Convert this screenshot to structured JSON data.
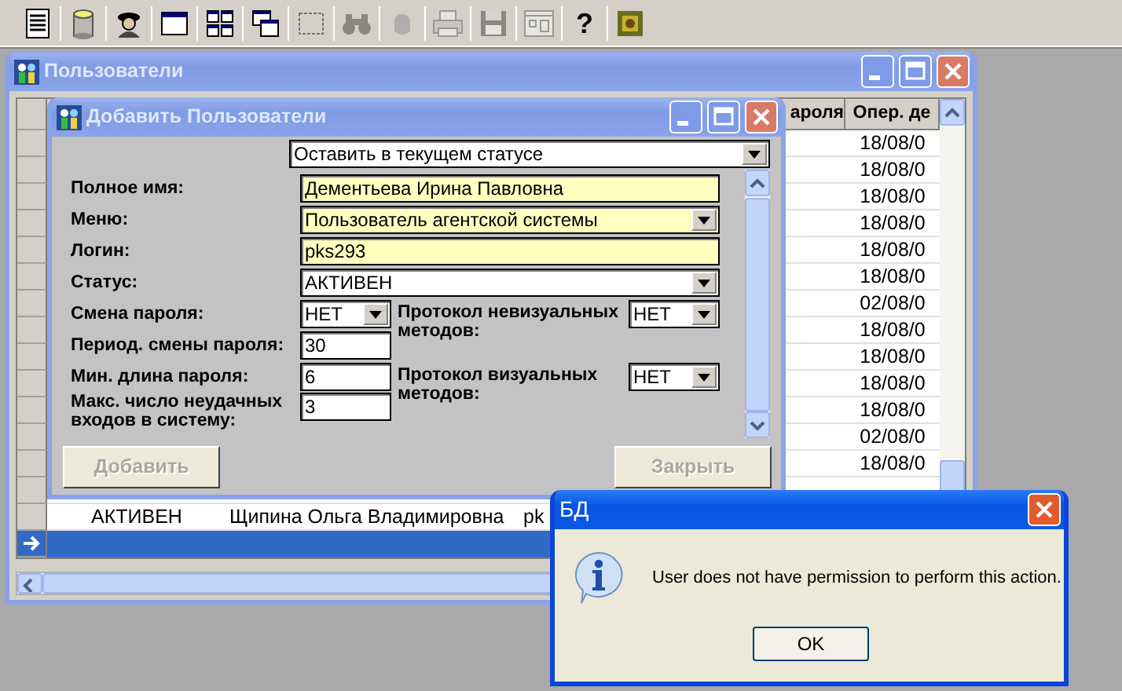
{
  "toolbar": [
    {
      "kind": "document",
      "disabled": false
    },
    {
      "kind": "database",
      "disabled": false
    },
    {
      "kind": "person",
      "disabled": false
    },
    {
      "kind": "window",
      "disabled": false
    },
    {
      "kind": "tile",
      "disabled": false
    },
    {
      "kind": "cascade",
      "disabled": false
    },
    {
      "kind": "frame",
      "disabled": true
    },
    {
      "kind": "binoculars",
      "disabled": true
    },
    {
      "kind": "hand",
      "disabled": true
    },
    {
      "kind": "printer",
      "disabled": true
    },
    {
      "kind": "save",
      "disabled": true
    },
    {
      "kind": "panel",
      "disabled": true
    },
    {
      "kind": "help",
      "glyph": "?",
      "disabled": false
    },
    {
      "kind": "emblem",
      "disabled": false
    }
  ],
  "users_window": {
    "title": "Пользователи",
    "active": false,
    "table": {
      "headings": {
        "column_4": "ароля",
        "column_5": "Опер. де"
      },
      "rows": [
        {
          "column_5": "18/08/0",
          "selected": false,
          "current": false
        },
        {
          "column_5": "18/08/0",
          "selected": false,
          "current": false
        },
        {
          "column_5": "18/08/0",
          "selected": false,
          "current": false
        },
        {
          "column_5": "18/08/0",
          "selected": false,
          "current": false
        },
        {
          "column_5": "18/08/0",
          "selected": false,
          "current": false
        },
        {
          "column_5": "18/08/0",
          "selected": false,
          "current": false
        },
        {
          "column_5": "02/08/0",
          "selected": false,
          "current": false
        },
        {
          "column_5": "18/08/0",
          "selected": false,
          "current": false
        },
        {
          "column_5": "18/08/0",
          "selected": false,
          "current": false
        },
        {
          "column_5": "18/08/0",
          "selected": false,
          "current": false
        },
        {
          "column_5": "18/08/0",
          "selected": false,
          "current": false
        },
        {
          "column_5": "02/08/0",
          "selected": false,
          "current": false
        },
        {
          "column_5": "18/08/0",
          "selected": false,
          "current": false
        },
        {
          "selected": false,
          "current": false
        },
        {
          "column_1": "АКТИВЕН",
          "column_2": "Щипина Ольга Владимировна",
          "column_3": "pk",
          "selected": false,
          "current": false
        },
        {
          "selected": true,
          "current": true
        }
      ]
    }
  },
  "add_dialog": {
    "title": "Добавить Пользователи",
    "active": false,
    "top_combo": {
      "value": "Оставить в текущем статусе"
    },
    "fields": [
      {
        "label": "Полное имя:",
        "kind": "text",
        "value": "Дементьева Ирина Павловна",
        "highlighted": true
      },
      {
        "label": "Меню:",
        "kind": "combo",
        "value": "Пользователь агентской системы",
        "highlighted": true
      },
      {
        "label": "Логин:",
        "kind": "text",
        "value": "pks293",
        "highlighted": true
      },
      {
        "label": "Статус:",
        "kind": "combo",
        "value": "АКТИВЕН",
        "highlighted": false
      }
    ],
    "settings": [
      {
        "label": "Смена пароля:",
        "kind": "combo",
        "value": "НЕТ"
      },
      {
        "label": "Период. смены пароля:",
        "kind": "text",
        "value": "30"
      },
      {
        "label": "Мин. длина пароля:",
        "kind": "text",
        "value": "6"
      },
      {
        "label": "Макс. число неудачных входов в систему:",
        "kind": "text",
        "value": "3"
      }
    ],
    "protocols": [
      {
        "label": "Протокол невизуальных методов:",
        "kind": "combo",
        "value": "НЕТ"
      },
      {
        "label": "Протокол визуальных методов:",
        "kind": "combo",
        "value": "НЕТ"
      }
    ],
    "buttons": [
      {
        "label": "Добавить",
        "disabled": true
      },
      {
        "label": "Закрыть",
        "disabled": true
      }
    ]
  },
  "message_box": {
    "title": "БД",
    "active": true,
    "message": "User does not have permission to perform this action.",
    "button": "OK"
  }
}
